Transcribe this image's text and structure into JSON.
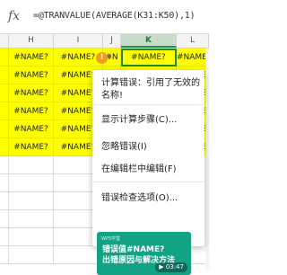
{
  "formula_bar": {
    "fx_label": "fx",
    "formula": "=@TRANVALUE(AVERAGE(K31:K50),1)"
  },
  "columns": [
    {
      "label": "H",
      "selected": false
    },
    {
      "label": "I",
      "selected": false
    },
    {
      "label": "J",
      "selected": false
    },
    {
      "label": "K",
      "selected": true
    },
    {
      "label": "L",
      "selected": false
    }
  ],
  "grid": {
    "error_value": "#NAME?",
    "partial_j": "#N",
    "rows": 12,
    "yellow_rows": 6
  },
  "error_indicator": {
    "icon": "warning-circle-icon",
    "glyph": "!",
    "caret": "▾",
    "color": "#f29c1f"
  },
  "context_menu": {
    "message": "计算错误：引用了无效的名称!",
    "items": [
      {
        "label": "显示计算步骤(C)..."
      },
      {
        "label": "忽略错误(I)"
      },
      {
        "label": "在编辑栏中编辑(F)"
      },
      {
        "label": "错误检查选项(O)..."
      }
    ]
  },
  "video_card": {
    "tag": "WPS学堂",
    "title_line1": "错误值#NAME?",
    "title_line2": "出错原因与解决方法",
    "duration": "03:47",
    "color": "#12a286"
  },
  "colors": {
    "highlight": "#ffff00",
    "selection": "#1f8a3a",
    "header_selected": "#c6dec9"
  }
}
